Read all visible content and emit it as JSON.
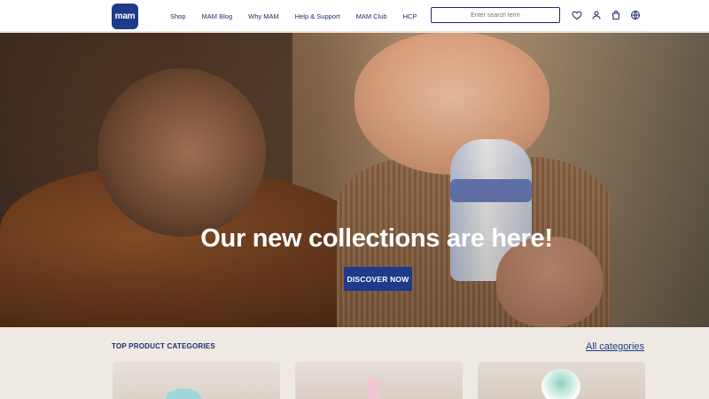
{
  "header": {
    "logo_text": "mam",
    "nav": [
      {
        "label": "Shop"
      },
      {
        "label": "MAM Blog"
      },
      {
        "label": "Why MAM"
      },
      {
        "label": "Help & Support"
      },
      {
        "label": "MAM Club"
      },
      {
        "label": "HCP"
      }
    ],
    "search": {
      "placeholder": "Enter search term"
    },
    "icons": [
      "heart-icon",
      "user-icon",
      "bag-icon",
      "globe-icon"
    ]
  },
  "hero": {
    "title": "Our new collections are here!",
    "cta_label": "DISCOVER NOW"
  },
  "categories": {
    "title": "TOP PRODUCT CATEGORIES",
    "link_label": "All categories"
  },
  "colors": {
    "brand": "#1f3a8a",
    "text": "#1f2b6d",
    "background": "#eee9e3"
  }
}
